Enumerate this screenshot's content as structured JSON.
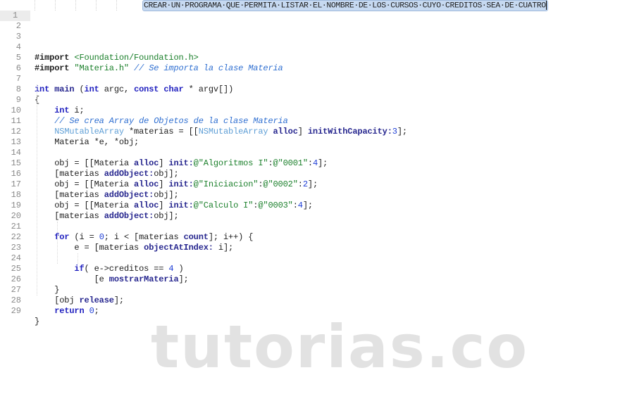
{
  "editor": {
    "current_line": 1,
    "banner_text": "CREAR·UN·PROGRAMA·QUE·PERMITA·LISTAR·EL·NOMBRE·DE·LOS·CURSOS·CUYO·CREDITOS·SEA·DE·CUATRO",
    "line_numbers": [
      "1",
      "2",
      "3",
      "4",
      "5",
      "6",
      "7",
      "8",
      "9",
      "10",
      "11",
      "12",
      "13",
      "14",
      "15",
      "16",
      "17",
      "18",
      "19",
      "20",
      "21",
      "22",
      "23",
      "24",
      "25",
      "26",
      "27",
      "28",
      "29"
    ],
    "lines": [
      "",
      "",
      "",
      "#import <Foundation/Foundation.h>",
      "#import \"Materia.h\" // Se importa la clase Materia",
      "",
      "int main (int argc, const char * argv[])",
      "{",
      "    int i;",
      "    // Se crea Array de Objetos de la clase Materia",
      "    NSMutableArray *materias = [[NSMutableArray alloc] initWithCapacity:3];",
      "    Materia *e, *obj;",
      "",
      "    obj = [[Materia alloc] init:@\"Algoritmos I\":@\"0001\":4];",
      "    [materias addObject:obj];",
      "    obj = [[Materia alloc] init:@\"Iniciacion\":@\"0002\":2];",
      "    [materias addObject:obj];",
      "    obj = [[Materia alloc] init:@\"Calculo I\":@\"0003\":4];",
      "    [materias addObject:obj];",
      "",
      "    for (i = 0; i < [materias count]; i++) {",
      "         e = [materias objectAtIndex: i];",
      "",
      "         if( e->creditos == 4 )",
      "             [e mostrarMateria];",
      "    }",
      "    [obj release];",
      "    return 0;",
      "}"
    ]
  },
  "tokens": {
    "l4": {
      "a": "#import",
      "b": " ",
      "c": "<Foundation/Foundation.h>"
    },
    "l5": {
      "a": "#import",
      "b": " ",
      "c": "\"Materia.h\"",
      "d": " ",
      "e": "// Se importa la clase Materia"
    },
    "l7": {
      "a": "int",
      "b": " ",
      "c": "main",
      "d": " (",
      "e": "int",
      "f": " argc, ",
      "g": "const",
      "h": " ",
      "i": "char",
      "j": " * argv[])"
    },
    "l8": {
      "a": "{"
    },
    "l9": {
      "a": "    ",
      "b": "int",
      "c": " i;"
    },
    "l10": {
      "a": "    ",
      "b": "// Se crea Array de Objetos de la clase Materia"
    },
    "l11": {
      "a": "    ",
      "b": "NSMutableArray",
      "c": " *materias = [[",
      "d": "NSMutableArray",
      "e": " ",
      "f": "alloc",
      "g": "] ",
      "h": "initWithCapacity:",
      "i": "3",
      "j": "];"
    },
    "l12": {
      "a": "    Materia *e, *obj;"
    },
    "l14": {
      "a": "    obj = [[Materia ",
      "b": "alloc",
      "c": "] ",
      "d": "init:",
      "e": "@\"Algoritmos I\"",
      "f": ":",
      "g": "@\"0001\"",
      "h": ":",
      "i": "4",
      "j": "];"
    },
    "l15": {
      "a": "    [materias ",
      "b": "addObject:",
      "c": "obj];"
    },
    "l16": {
      "a": "    obj = [[Materia ",
      "b": "alloc",
      "c": "] ",
      "d": "init:",
      "e": "@\"Iniciacion\"",
      "f": ":",
      "g": "@\"0002\"",
      "h": ":",
      "i": "2",
      "j": "];"
    },
    "l17": {
      "a": "    [materias ",
      "b": "addObject:",
      "c": "obj];"
    },
    "l18": {
      "a": "    obj = [[Materia ",
      "b": "alloc",
      "c": "] ",
      "d": "init:",
      "e": "@\"Calculo I\"",
      "f": ":",
      "g": "@\"0003\"",
      "h": ":",
      "i": "4",
      "j": "];"
    },
    "l19": {
      "a": "    [materias ",
      "b": "addObject:",
      "c": "obj];"
    },
    "l21": {
      "a": "    ",
      "b": "for",
      "c": " (i = ",
      "d": "0",
      "e": "; i < [materias ",
      "f": "count",
      "g": "]; i++) {"
    },
    "l22": {
      "a": "        e = [materias ",
      "b": "objectAtIndex:",
      "c": " i];"
    },
    "l24": {
      "a": "        ",
      "b": "if",
      "c": "( e->creditos == ",
      "d": "4",
      "e": " )"
    },
    "l25": {
      "a": "            [e ",
      "b": "mostrarMateria",
      "c": "];"
    },
    "l26": {
      "a": "    }"
    },
    "l27": {
      "a": "    [obj ",
      "b": "release",
      "c": "];"
    },
    "l28": {
      "a": "    ",
      "b": "return",
      "c": " ",
      "d": "0",
      "e": ";"
    },
    "l29": {
      "a": "}"
    }
  },
  "watermark": {
    "text": "tutorias.co"
  },
  "colors": {
    "keyword": "#1f1fbf",
    "type": "#5f9fd6",
    "string": "#1a7f2a",
    "comment": "#2f6fd1",
    "number": "#1f3fd6",
    "selection_bg": "#c6d9f1",
    "current_line_gutter": "#ececec",
    "watermark": "#e2e2e2"
  }
}
